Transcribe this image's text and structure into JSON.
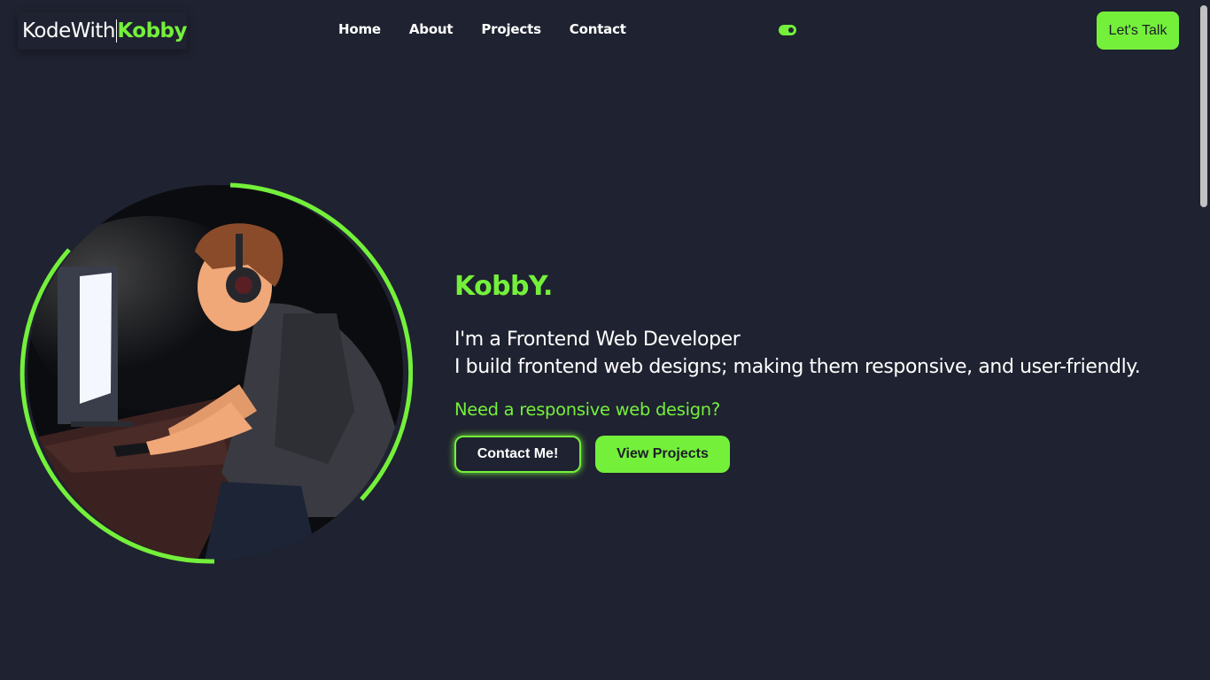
{
  "colors": {
    "accent": "#74f03b",
    "background": "#1f2230",
    "text": "#ffffff"
  },
  "nav": {
    "logo_prefix": "KodeWith",
    "logo_accent": "Kobby",
    "links": [
      "Home",
      "About",
      "Projects",
      "Contact"
    ],
    "theme_toggle_icon": "toggle-switch-icon",
    "cta_label": "Let's Talk"
  },
  "hero": {
    "image": "developer-at-computer-illustration",
    "name": "KobbY.",
    "role": "I'm a Frontend Web Developer",
    "description": "I build frontend web designs; making them responsive, and user-friendly.",
    "question": "Need a responsive web design?",
    "contact_button": "Contact Me!",
    "projects_button": "View Projects"
  }
}
